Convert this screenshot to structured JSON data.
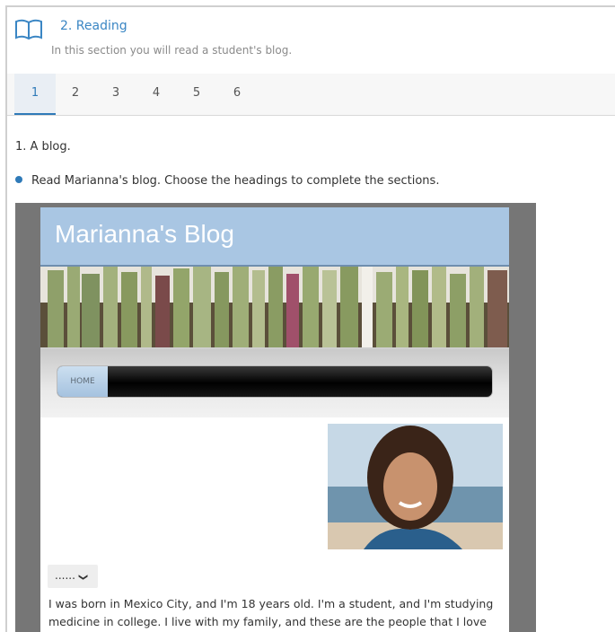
{
  "section": {
    "title": "2. Reading",
    "subtitle": "In this section you will read a student's blog."
  },
  "tabs": [
    {
      "label": "1",
      "active": true
    },
    {
      "label": "2",
      "active": false
    },
    {
      "label": "3",
      "active": false
    },
    {
      "label": "4",
      "active": false
    },
    {
      "label": "5",
      "active": false
    },
    {
      "label": "6",
      "active": false
    }
  ],
  "activity": {
    "title": "1. A blog.",
    "instruction": "Read Marianna's blog. Choose the headings to complete the sections."
  },
  "blog": {
    "title": "Marianna's Blog",
    "nav_home": "HOME",
    "dropdown_value": "......",
    "text": "I was born in Mexico City, and I'm 18 years old. I'm a student, and I'm studying medicine in college. I live with my family, and these are the people that I love"
  },
  "colors": {
    "accent": "#2f7ab8",
    "blog_header": "#a9c6e3"
  },
  "icons": {
    "section": "book-icon",
    "dropdown": "chevron-down-icon"
  }
}
